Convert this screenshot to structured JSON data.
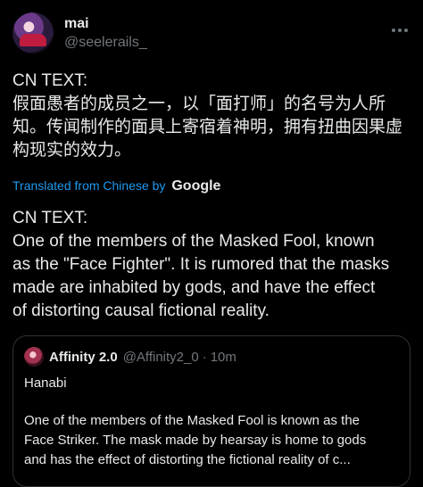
{
  "author": {
    "name": "mai",
    "handle": "@seelerails_"
  },
  "post": {
    "cn_label": "CN TEXT:",
    "cn_lines": [
      "假面愚者的成员之一，以「面打师」的名号为人所",
      "知。传闻制作的面具上寄宿着神明，拥有扭曲因果虚",
      "构现实的效力。"
    ],
    "translated_by": "Translated from Chinese by",
    "translator_brand": "Google",
    "en_label": "CN TEXT:",
    "en_lines": [
      "One of the members of the Masked Fool, known",
      "as the \"Face Fighter\". It is rumored that the masks",
      "made are inhabited by gods, and have the effect",
      "of distorting causal fictional reality."
    ]
  },
  "quote": {
    "name": "Affinity 2.0",
    "handle": "@Affinity2_0",
    "separator": "·",
    "time": "10m",
    "title": "Hanabi",
    "lines": [
      "One of the members of the Masked Fool is known as the",
      "Face Striker. The mask made by hearsay is home to gods",
      "and has the effect of distorting the fictional reality of c..."
    ]
  },
  "icons": {
    "more": "more-horizontal-icon"
  }
}
